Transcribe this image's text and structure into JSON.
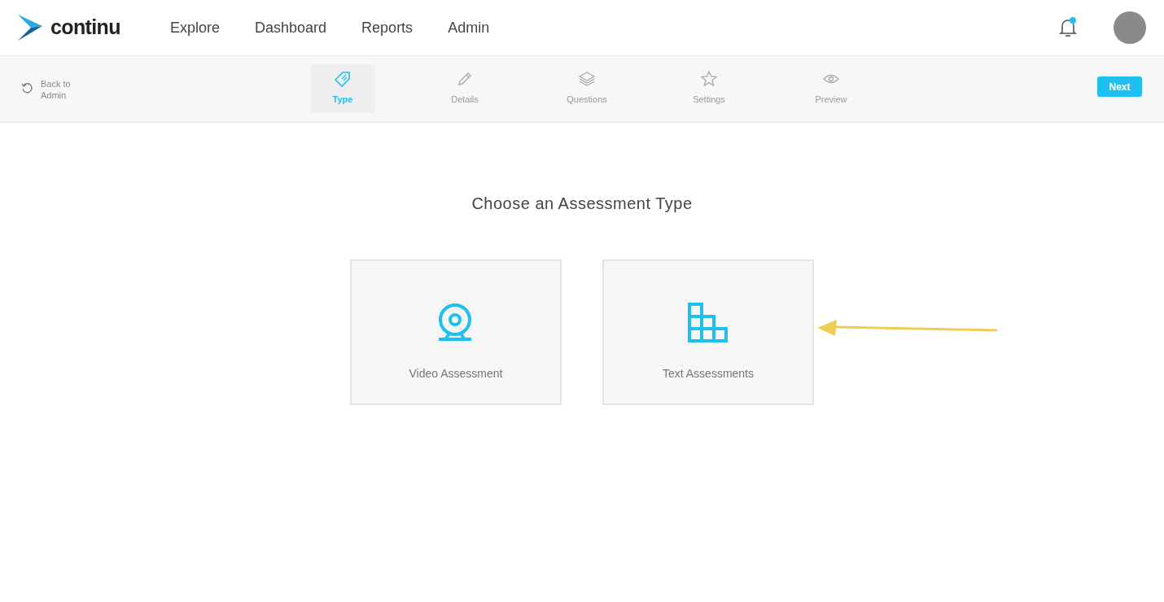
{
  "brand": {
    "name": "continu"
  },
  "nav": [
    {
      "label": "Explore"
    },
    {
      "label": "Dashboard"
    },
    {
      "label": "Reports"
    },
    {
      "label": "Admin"
    }
  ],
  "notifications": {
    "unread": true
  },
  "back_link": {
    "label": "Back to Admin"
  },
  "steps": [
    {
      "label": "Type",
      "kind": "tag",
      "selected": true
    },
    {
      "label": "Details",
      "kind": "pencil",
      "selected": false
    },
    {
      "label": "Questions",
      "kind": "layers",
      "selected": false
    },
    {
      "label": "Settings",
      "kind": "star",
      "selected": false
    },
    {
      "label": "Preview",
      "kind": "eye",
      "selected": false
    }
  ],
  "next_button": {
    "label": "Next"
  },
  "heading": "Choose an Assessment Type",
  "options": [
    {
      "label": "Video Assessment",
      "kind": "webcam"
    },
    {
      "label": "Text Assessments",
      "kind": "blocks"
    }
  ]
}
